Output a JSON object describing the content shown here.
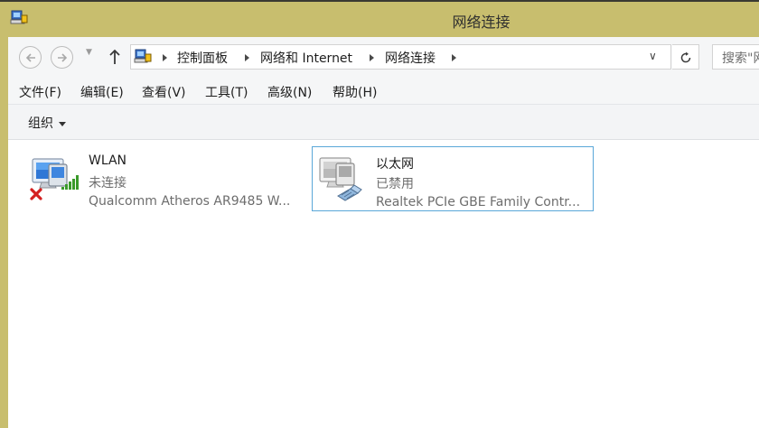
{
  "window": {
    "title": "网络连接"
  },
  "nav": {
    "back_label": "←",
    "forward_label": "→",
    "up_label": "↑"
  },
  "address": {
    "breadcrumbs": [
      "控制面板",
      "网络和 Internet",
      "网络连接"
    ]
  },
  "search": {
    "placeholder": "搜索\"网络连接\""
  },
  "menu": [
    "文件(F)",
    "编辑(E)",
    "查看(V)",
    "工具(T)",
    "高级(N)",
    "帮助(H)"
  ],
  "command_bar": {
    "organize_label": "组织"
  },
  "adapters": [
    {
      "name": "WLAN",
      "status": "未连接",
      "device": "Qualcomm Atheros AR9485 W...",
      "icon": "wireless-adapter-disconnected-icon",
      "selected": false
    },
    {
      "name": "以太网",
      "status": "已禁用",
      "device": "Realtek PCIe GBE Family Contr...",
      "icon": "ethernet-adapter-disabled-icon",
      "selected": true
    }
  ],
  "colors": {
    "titlebar": "#c8be6e",
    "selection_border": "#5aa7d8",
    "status_text": "#6d6d6d",
    "error_red": "#d42020",
    "signal_green": "#3a9a2a"
  }
}
